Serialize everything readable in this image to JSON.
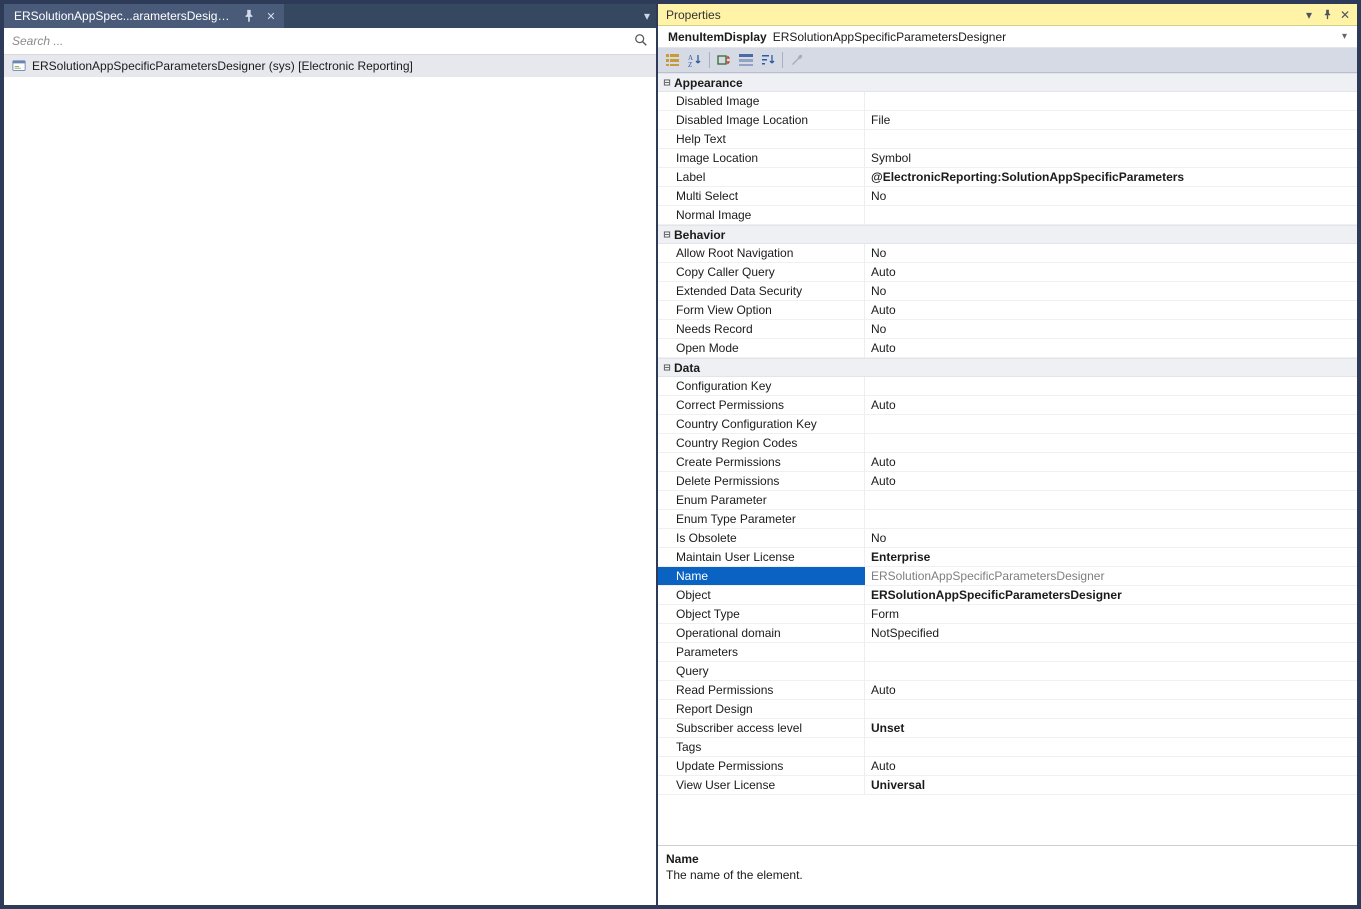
{
  "left": {
    "tab_title": "ERSolutionAppSpec...arametersDesigner",
    "search_placeholder": "Search ...",
    "tree_root": "ERSolutionAppSpecificParametersDesigner (sys) [Electronic Reporting]"
  },
  "right": {
    "panel_title": "Properties",
    "object_type": "MenuItemDisplay",
    "object_name": "ERSolutionAppSpecificParametersDesigner",
    "description": {
      "name": "Name",
      "text": "The name of the element."
    },
    "selected_property": "Name",
    "categories": [
      {
        "name": "Appearance",
        "rows": [
          {
            "name": "Disabled Image",
            "value": ""
          },
          {
            "name": "Disabled Image Location",
            "value": "File"
          },
          {
            "name": "Help Text",
            "value": ""
          },
          {
            "name": "Image Location",
            "value": "Symbol"
          },
          {
            "name": "Label",
            "value": "@ElectronicReporting:SolutionAppSpecificParameters",
            "bold": true
          },
          {
            "name": "Multi Select",
            "value": "No"
          },
          {
            "name": "Normal Image",
            "value": ""
          }
        ]
      },
      {
        "name": "Behavior",
        "rows": [
          {
            "name": "Allow Root Navigation",
            "value": "No"
          },
          {
            "name": "Copy Caller Query",
            "value": "Auto"
          },
          {
            "name": "Extended Data Security",
            "value": "No"
          },
          {
            "name": "Form View Option",
            "value": "Auto"
          },
          {
            "name": "Needs Record",
            "value": "No"
          },
          {
            "name": "Open Mode",
            "value": "Auto"
          }
        ]
      },
      {
        "name": "Data",
        "rows": [
          {
            "name": "Configuration Key",
            "value": ""
          },
          {
            "name": "Correct Permissions",
            "value": "Auto"
          },
          {
            "name": "Country Configuration Key",
            "value": ""
          },
          {
            "name": "Country Region Codes",
            "value": ""
          },
          {
            "name": "Create Permissions",
            "value": "Auto"
          },
          {
            "name": "Delete Permissions",
            "value": "Auto"
          },
          {
            "name": "Enum Parameter",
            "value": ""
          },
          {
            "name": "Enum Type Parameter",
            "value": ""
          },
          {
            "name": "Is Obsolete",
            "value": "No"
          },
          {
            "name": "Maintain User License",
            "value": "Enterprise",
            "bold": true
          },
          {
            "name": "Name",
            "value": "ERSolutionAppSpecificParametersDesigner"
          },
          {
            "name": "Object",
            "value": "ERSolutionAppSpecificParametersDesigner",
            "bold": true
          },
          {
            "name": "Object Type",
            "value": "Form"
          },
          {
            "name": "Operational domain",
            "value": "NotSpecified"
          },
          {
            "name": "Parameters",
            "value": ""
          },
          {
            "name": "Query",
            "value": ""
          },
          {
            "name": "Read Permissions",
            "value": "Auto"
          },
          {
            "name": "Report Design",
            "value": ""
          },
          {
            "name": "Subscriber access level",
            "value": "Unset",
            "bold": true
          },
          {
            "name": "Tags",
            "value": ""
          },
          {
            "name": "Update Permissions",
            "value": "Auto"
          },
          {
            "name": "View User License",
            "value": "Universal",
            "bold": true
          }
        ]
      }
    ]
  },
  "colors": {
    "selection_bg": "#0a63c2",
    "header_bg": "#fff3a8",
    "frame": "#2d3a58"
  },
  "search_icon_glyph": "🔍"
}
